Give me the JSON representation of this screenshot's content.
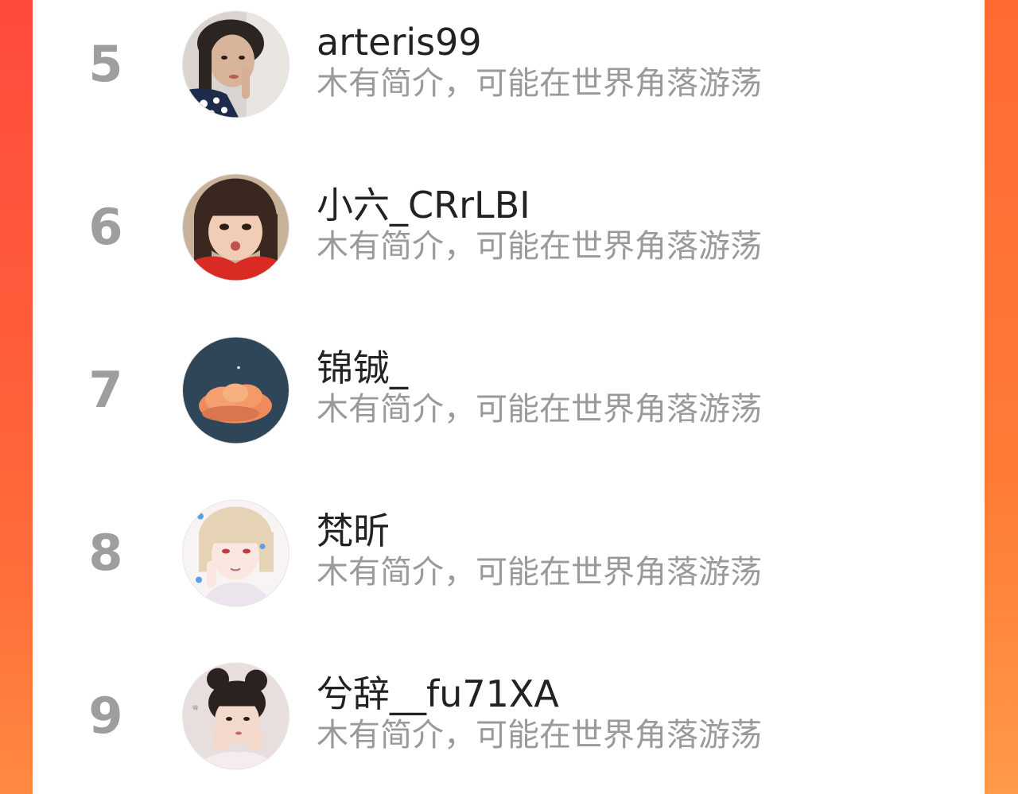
{
  "users": [
    {
      "rank": "5",
      "name": "arteris99",
      "bio": "木有简介，可能在世界角落游荡",
      "avatar": "avatar-photo-girl-hand"
    },
    {
      "rank": "6",
      "name": "小六_CRrLBI",
      "bio": "木有简介，可能在世界角落游荡",
      "avatar": "avatar-photo-child"
    },
    {
      "rank": "7",
      "name": "锦铖_",
      "bio": "木有简介，可能在世界角落游荡",
      "avatar": "avatar-cloud-night"
    },
    {
      "rank": "8",
      "name": "梵昕",
      "bio": "木有简介，可能在世界角落游荡",
      "avatar": "avatar-anime-boy"
    },
    {
      "rank": "9",
      "name": "兮辞__fu71XA",
      "bio": "木有简介，可能在世界角落游荡",
      "avatar": "avatar-photo-girl-buns"
    }
  ],
  "colors": {
    "background": "#ff5a3a",
    "rank": "#9e9e9e",
    "name": "#222222",
    "bio": "#9a9a9a"
  }
}
